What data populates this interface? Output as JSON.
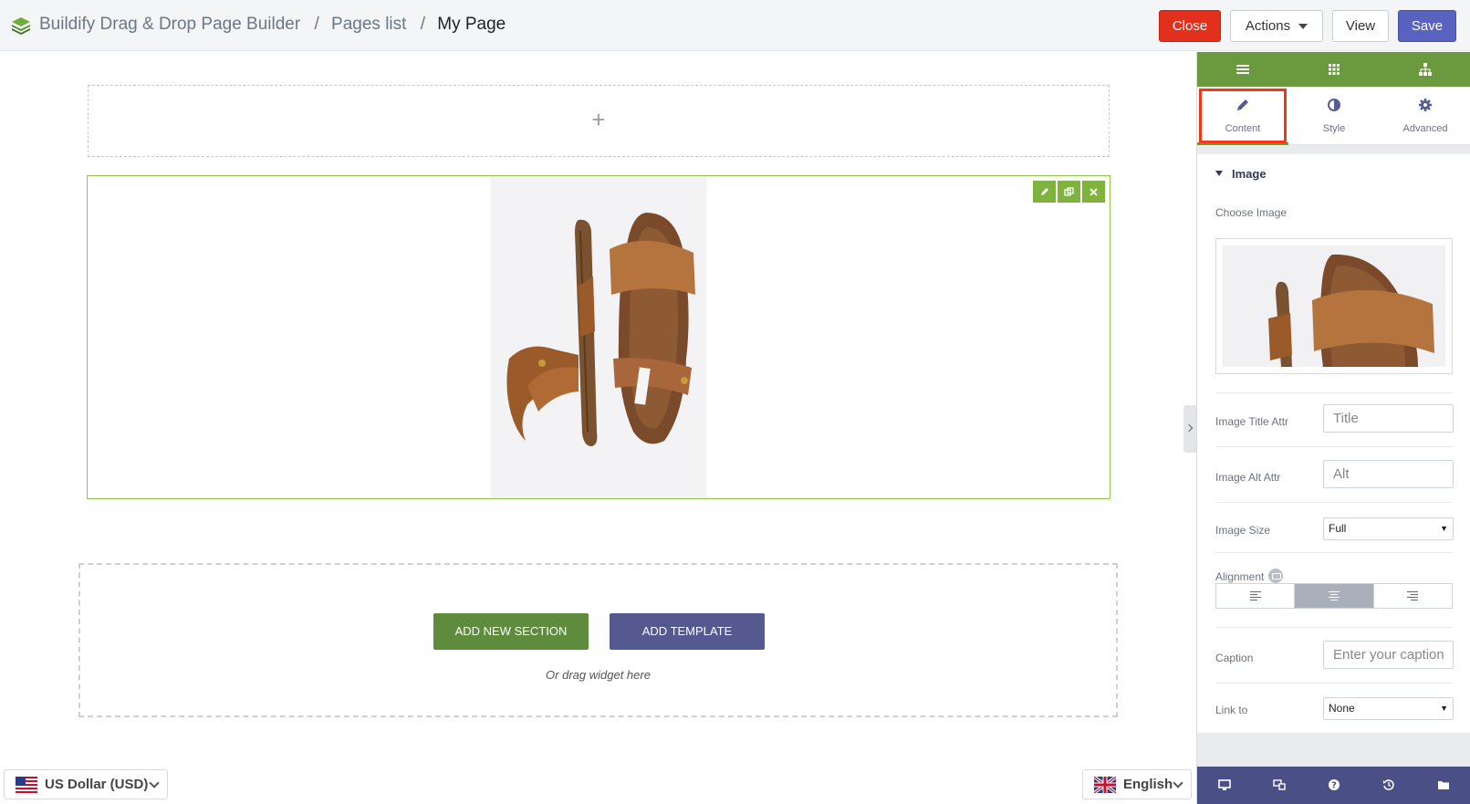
{
  "header": {
    "app_title": "Buildify Drag & Drop Page Builder",
    "breadcrumb_separator": "/",
    "breadcrumb_pages": "Pages list",
    "breadcrumb_current": "My Page",
    "close_label": "Close",
    "actions_label": "Actions",
    "view_label": "View",
    "save_label": "Save",
    "colors": {
      "close": "#e2301c",
      "save": "#5a62c0"
    }
  },
  "canvas": {
    "add_section_plus": "+",
    "section_tools": [
      "pencil-icon",
      "duplicate-icon",
      "delete-icon"
    ],
    "image_widget": {
      "icon": "sandal-photo"
    },
    "add_new_section_label": "ADD NEW SECTION",
    "add_template_label": "ADD TEMPLATE",
    "drag_hint": "Or drag widget here"
  },
  "footer": {
    "currency": {
      "flag": "us-flag-icon",
      "label": "US Dollar (USD)"
    },
    "language": {
      "flag": "uk-flag-icon",
      "label": "English"
    }
  },
  "panel": {
    "head_icons": [
      "hamburger-icon",
      "grid-icon",
      "sitemap-icon"
    ],
    "tabs": [
      {
        "label": "Content",
        "icon": "pencil-icon",
        "active": true
      },
      {
        "label": "Style",
        "icon": "half-circle-icon",
        "active": false
      },
      {
        "label": "Advanced",
        "icon": "gear-icon",
        "active": false
      }
    ],
    "section_title": "Image",
    "fields": {
      "choose_image_label": "Choose Image",
      "title_attr_label": "Image Title Attr",
      "title_attr_placeholder": "Title",
      "alt_attr_label": "Image Alt Attr",
      "alt_attr_placeholder": "Alt",
      "image_size_label": "Image Size",
      "image_size_value": "Full",
      "alignment_label": "Alignment",
      "alignment_options": [
        "left",
        "center",
        "right"
      ],
      "alignment_selected": "center",
      "caption_label": "Caption",
      "caption_placeholder": "Enter your caption",
      "link_to_label": "Link to",
      "link_to_value": "None"
    },
    "footer_icons": [
      "desktop-icon",
      "responsive-icon",
      "help-icon",
      "history-icon",
      "folder-icon"
    ],
    "colors": {
      "head": "#6b9a3e",
      "foot": "#4a4f86",
      "highlight": "#f03a17"
    }
  }
}
